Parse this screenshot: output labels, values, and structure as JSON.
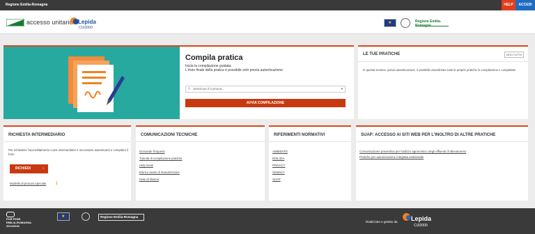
{
  "topbar": {
    "region": "Regione Emilia-Romagna",
    "help": "HELP",
    "login": "ACCEDI"
  },
  "header": {
    "brand": "accesso unitario",
    "lepida": "Lepida",
    "lepida_sub": "CUI2000",
    "rer_logo": "Regione Emilia-Romagna"
  },
  "hero": {
    "title": "Compila pratica",
    "subtitle1": "Inizia la compilazione guidata.",
    "subtitle2": "L'invio finale della pratica è possibile solo previa autenticazione",
    "select_placeholder": "Seleziona il Comune...",
    "button": "AVVIA COMPILAZIONE"
  },
  "pratiche": {
    "title": "LE TUE PRATICHE",
    "button": "VEDI TUTTE",
    "description": "In questa sezione, previa autenticazione, è possibile visualizzare tutte le proprie pratiche in compilazione e completate"
  },
  "intermediario": {
    "title": "RICHIESTA INTERMEDIARIO",
    "description": "Per richiedere l'accreditamento come intermediario è necessario autenticarsi e compilare il form",
    "button": "RICHIEDI",
    "modello": "Modello di procura speciale"
  },
  "comunicazioni": {
    "title": "COMUNICAZIONI TECNICHE",
    "links": [
      "Domande frequenti",
      "Tutorial di compilazione pratiche",
      "Help Desk",
      "Elenco avvisi di manutenzione",
      "Note di rilascio"
    ]
  },
  "riferimenti": {
    "title": "RIFERIMENTI NORMATIVI",
    "links": [
      "AMBIENTE",
      "EDILIZIA",
      "PRIVACY",
      "SISMICA",
      "SUAP"
    ]
  },
  "suap": {
    "title": "SUAP: ACCESSO AI SITI WEB PER L'INOLTRO DI ALTRE PRATICHE",
    "links": [
      "Comunicazione preventiva per l'utilizzo agronomico degli effluenti di allevamento",
      "Pratiche per autorizzazione integrata ambientale"
    ]
  },
  "footer": {
    "por_line1": "POR FESR",
    "por_line2": "EMILIA-ROMAGNA",
    "por_line3": "2014/2020",
    "rer": "Regione Emilia-Romagna",
    "realizzato": "Realizzato e gestito da",
    "lepida": "Lepida",
    "lepida_sub": "CUI2000"
  }
}
